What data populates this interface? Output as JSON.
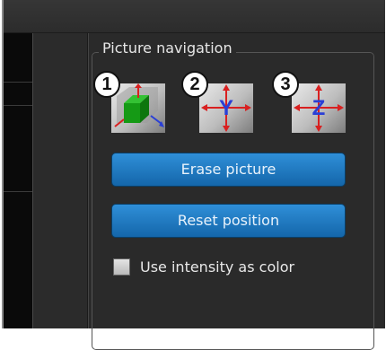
{
  "panel": {
    "title": "Picture navigation",
    "nav_buttons": [
      {
        "badge": "1",
        "icon": "cube-view-icon"
      },
      {
        "badge": "2",
        "icon": "axis-y-view-icon",
        "axis_letter": "Y"
      },
      {
        "badge": "3",
        "icon": "axis-z-view-icon",
        "axis_letter": "Z"
      }
    ],
    "erase_label": "Erase picture",
    "reset_label": "Reset position",
    "checkbox": {
      "label": "Use intensity as color",
      "checked": false
    }
  },
  "colors": {
    "accent_button": "#1f7cc6",
    "panel_bg": "#2a2a2a",
    "axis_red": "#d92020",
    "axis_blue": "#2a3fd6",
    "cube_green": "#1aa81a"
  }
}
